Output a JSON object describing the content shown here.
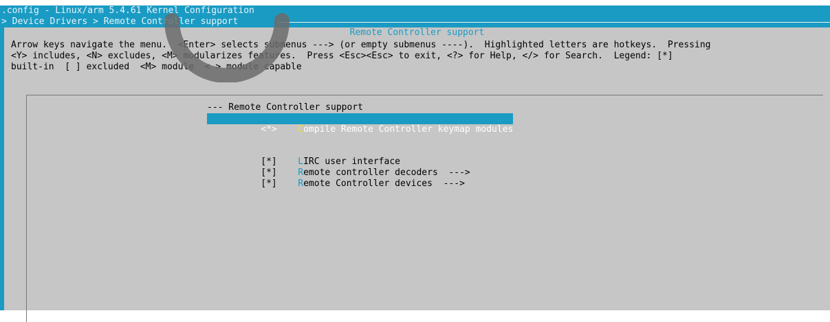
{
  "window": {
    "title": ".config - Linux/arm 5.4.61 Kernel Configuration",
    "breadcrumb": "> Device Drivers > Remote Controller support"
  },
  "dialog": {
    "title": "Remote Controller support",
    "help_text": "Arrow keys navigate the menu.  <Enter> selects submenus ---> (or empty submenus ----).  Highlighted letters are hotkeys.  Pressing\n<Y> includes, <N> excludes, <M> modularizes features.  Press <Esc><Esc> to exit, <?> for Help, </> for Search.  Legend: [*]\nbuilt-in  [ ] excluded  <M> module  < > module capable"
  },
  "menu": {
    "header": "--- Remote Controller support",
    "items": [
      {
        "mark": "<*>",
        "hotkey": "C",
        "rest": "ompile Remote Controller keymap modules",
        "selected": true
      },
      {
        "mark": "[*]",
        "hotkey": "L",
        "rest": "IRC user interface",
        "selected": false
      },
      {
        "mark": "[*]",
        "hotkey": "R",
        "rest": "emote controller decoders  --->",
        "selected": false
      },
      {
        "mark": "[*]",
        "hotkey": "R",
        "rest": "emote Controller devices  --->",
        "selected": false
      }
    ]
  },
  "colors": {
    "terminal_bg": "#1a9bc4",
    "dialog_bg": "#c6c6c6",
    "hotkey": "#1a9bc4",
    "selected_hotkey": "#f5e400"
  }
}
